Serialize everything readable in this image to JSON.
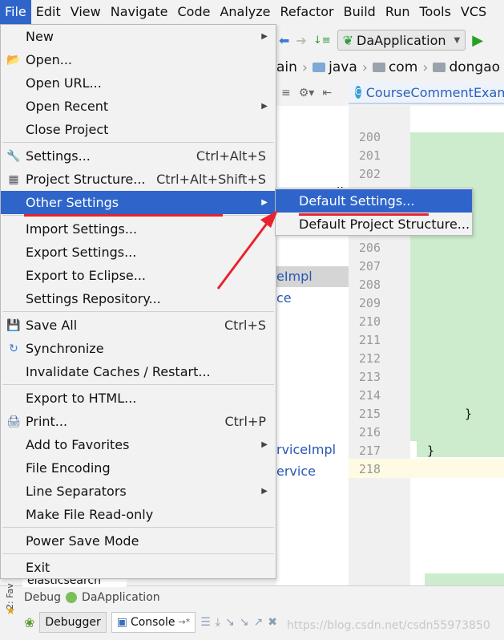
{
  "menubar": {
    "items": [
      "File",
      "Edit",
      "View",
      "Navigate",
      "Code",
      "Analyze",
      "Refactor",
      "Build",
      "Run",
      "Tools",
      "VCS"
    ],
    "active": "File"
  },
  "toolbar": {
    "run_config": "DaApplication"
  },
  "breadcrumb": [
    "ain",
    "java",
    "com",
    "dongao"
  ],
  "editor_tab": {
    "label": "CourseCommentExam"
  },
  "project_panel": {
    "items": [
      {
        "label": "eImpl",
        "selected": true
      },
      {
        "label": "ce",
        "selected": false
      },
      {
        "label": "rviceImpl",
        "selected": false
      },
      {
        "label": "ervice",
        "selected": false
      }
    ],
    "partial_glyph": "ll"
  },
  "editor": {
    "line_numbers": [
      "200",
      "201",
      "202",
      "206",
      "207",
      "208",
      "209",
      "210",
      "211",
      "212",
      "213",
      "214",
      "215",
      "216",
      "217",
      "218"
    ],
    "brace_inner": "}",
    "brace_outer": "}"
  },
  "file_menu": {
    "items": [
      {
        "label": "New",
        "shortcut": "",
        "submenu": true,
        "icon": ""
      },
      {
        "label": "Open...",
        "shortcut": "",
        "submenu": false,
        "icon": "folder-open-icon"
      },
      {
        "label": "Open URL...",
        "shortcut": "",
        "submenu": false,
        "icon": ""
      },
      {
        "label": "Open Recent",
        "shortcut": "",
        "submenu": true,
        "icon": ""
      },
      {
        "label": "Close Project",
        "shortcut": "",
        "submenu": false,
        "icon": ""
      },
      {
        "label": "Settings...",
        "shortcut": "Ctrl+Alt+S",
        "submenu": false,
        "icon": "wrench-icon"
      },
      {
        "label": "Project Structure...",
        "shortcut": "Ctrl+Alt+Shift+S",
        "submenu": false,
        "icon": "project-structure-icon"
      },
      {
        "label": "Other Settings",
        "shortcut": "",
        "submenu": true,
        "icon": "",
        "highlighted": true
      },
      {
        "label": "Import Settings...",
        "shortcut": "",
        "submenu": false,
        "icon": ""
      },
      {
        "label": "Export Settings...",
        "shortcut": "",
        "submenu": false,
        "icon": ""
      },
      {
        "label": "Export to Eclipse...",
        "shortcut": "",
        "submenu": false,
        "icon": ""
      },
      {
        "label": "Settings Repository...",
        "shortcut": "",
        "submenu": false,
        "icon": ""
      },
      {
        "label": "Save All",
        "shortcut": "Ctrl+S",
        "submenu": false,
        "icon": "save-icon"
      },
      {
        "label": "Synchronize",
        "shortcut": "",
        "submenu": false,
        "icon": "sync-icon"
      },
      {
        "label": "Invalidate Caches / Restart...",
        "shortcut": "",
        "submenu": false,
        "icon": ""
      },
      {
        "label": "Export to HTML...",
        "shortcut": "",
        "submenu": false,
        "icon": ""
      },
      {
        "label": "Print...",
        "shortcut": "Ctrl+P",
        "submenu": false,
        "icon": "print-icon"
      },
      {
        "label": "Add to Favorites",
        "shortcut": "",
        "submenu": true,
        "icon": ""
      },
      {
        "label": "File Encoding",
        "shortcut": "",
        "submenu": false,
        "icon": ""
      },
      {
        "label": "Line Separators",
        "shortcut": "",
        "submenu": true,
        "icon": ""
      },
      {
        "label": "Make File Read-only",
        "shortcut": "",
        "submenu": false,
        "icon": ""
      },
      {
        "label": "Power Save Mode",
        "shortcut": "",
        "submenu": false,
        "icon": ""
      },
      {
        "label": "Exit",
        "shortcut": "",
        "submenu": false,
        "icon": ""
      }
    ]
  },
  "submenu": {
    "items": [
      {
        "label": "Default Settings...",
        "highlighted": true
      },
      {
        "label": "Default Project Structure...",
        "highlighted": false
      }
    ]
  },
  "bottom": {
    "elastic": "elasticsearch",
    "side_tab": "2: Fav",
    "debug_label": "Debug",
    "debug_config": "DaApplication",
    "tabs": [
      "Debugger",
      "Console"
    ],
    "watermark": "https://blog.csdn.net/csdn55973850"
  },
  "colors": {
    "menu_highlight": "#2f65ca",
    "annotation": "#e8232d",
    "diff_green": "#cdeccd"
  }
}
